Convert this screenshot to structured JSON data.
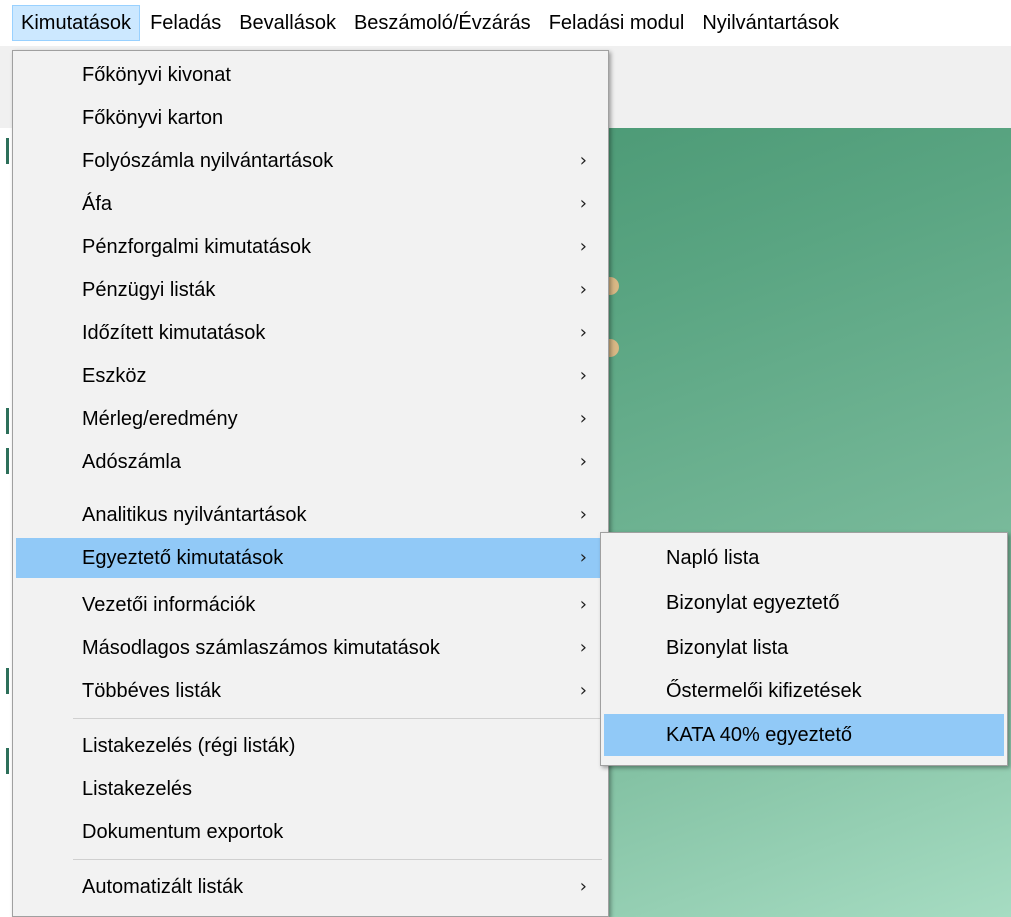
{
  "menubar": {
    "items": [
      {
        "label": "Kimutatások",
        "active": true
      },
      {
        "label": "Feladás"
      },
      {
        "label": "Bevallások"
      },
      {
        "label": "Beszámoló/Évzárás"
      },
      {
        "label": "Feladási modul"
      },
      {
        "label": "Nyilvántartások"
      }
    ]
  },
  "main_menu": {
    "items": [
      {
        "label": "Főkönyvi kivonat",
        "has_submenu": false
      },
      {
        "label": "Főkönyvi karton",
        "has_submenu": false
      },
      {
        "label": "Folyószámla nyilvántartások",
        "has_submenu": true
      },
      {
        "label": "Áfa",
        "has_submenu": true
      },
      {
        "label": "Pénzforgalmi kimutatások",
        "has_submenu": true
      },
      {
        "label": "Pénzügyi listák",
        "has_submenu": true
      },
      {
        "label": "Időzített kimutatások",
        "has_submenu": true
      },
      {
        "label": "Eszköz",
        "has_submenu": true
      },
      {
        "label": "Mérleg/eredmény",
        "has_submenu": true
      },
      {
        "label": "Adószámla",
        "has_submenu": true
      },
      {
        "label": "Analitikus nyilvántartások",
        "has_submenu": true
      },
      {
        "label": "Egyeztető kimutatások",
        "has_submenu": true,
        "highlighted": true
      },
      {
        "label": "Vezetői információk",
        "has_submenu": true
      },
      {
        "label": "Másodlagos számlaszámos kimutatások",
        "has_submenu": true
      },
      {
        "label": "Többéves listák",
        "has_submenu": true
      },
      {
        "label": "Listakezelés (régi listák)",
        "has_submenu": false
      },
      {
        "label": "Listakezelés",
        "has_submenu": false
      },
      {
        "label": "Dokumentum exportok",
        "has_submenu": false
      },
      {
        "label": "Automatizált listák",
        "has_submenu": true
      }
    ],
    "arrow_glyph": "›"
  },
  "sub_menu": {
    "items": [
      {
        "label": "Napló lista"
      },
      {
        "label": "Bizonylat egyeztető"
      },
      {
        "label": "Bizonylat lista"
      },
      {
        "label": "Őstermelői kifizetések"
      },
      {
        "label": "KATA 40% egyeztető",
        "highlighted": true
      }
    ]
  },
  "colors": {
    "highlight": "#91c9f7",
    "menubar_active": "#cce8ff",
    "menu_bg": "#f2f2f2",
    "background_green": "#5aa582"
  }
}
